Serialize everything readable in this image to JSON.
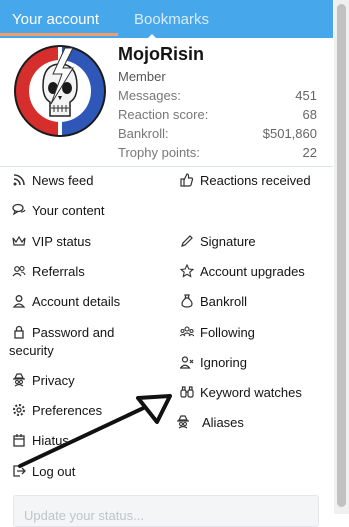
{
  "tabs": {
    "active": "Your account",
    "inactive": "Bookmarks"
  },
  "user": {
    "name": "MojoRisin",
    "title": "Member",
    "stats": [
      {
        "label": "Messages:",
        "value": "451"
      },
      {
        "label": "Reaction score:",
        "value": "68"
      },
      {
        "label": "Bankroll:",
        "value": "$501,860"
      },
      {
        "label": "Trophy points:",
        "value": "22"
      }
    ]
  },
  "menu": {
    "left": [
      "News feed",
      "Your content",
      "VIP status",
      "Referrals",
      "Account details",
      "Password and",
      "security",
      "Privacy",
      "Preferences",
      "Hiatus",
      "Log out"
    ],
    "right": [
      "Reactions received",
      "Signature",
      "Account upgrades",
      "Bankroll",
      "Following",
      "Ignoring",
      "Keyword watches",
      "Aliases"
    ]
  },
  "status": {
    "placeholder": "Update your status..."
  },
  "icons": [
    "rss-icon",
    "thumbs-up-icon",
    "comments-icon",
    "crown-icon",
    "pencil-icon",
    "star-icon",
    "users-icon",
    "user-icon",
    "money-bag-icon",
    "lock-icon",
    "users-follow-icon",
    "user-x-icon",
    "binoculars-icon",
    "spy-icon",
    "gear-icon",
    "calendar-icon",
    "logout-icon"
  ],
  "colors": {
    "tab_bar": "#47a7eb",
    "tab_underline": "#f29d6b"
  }
}
